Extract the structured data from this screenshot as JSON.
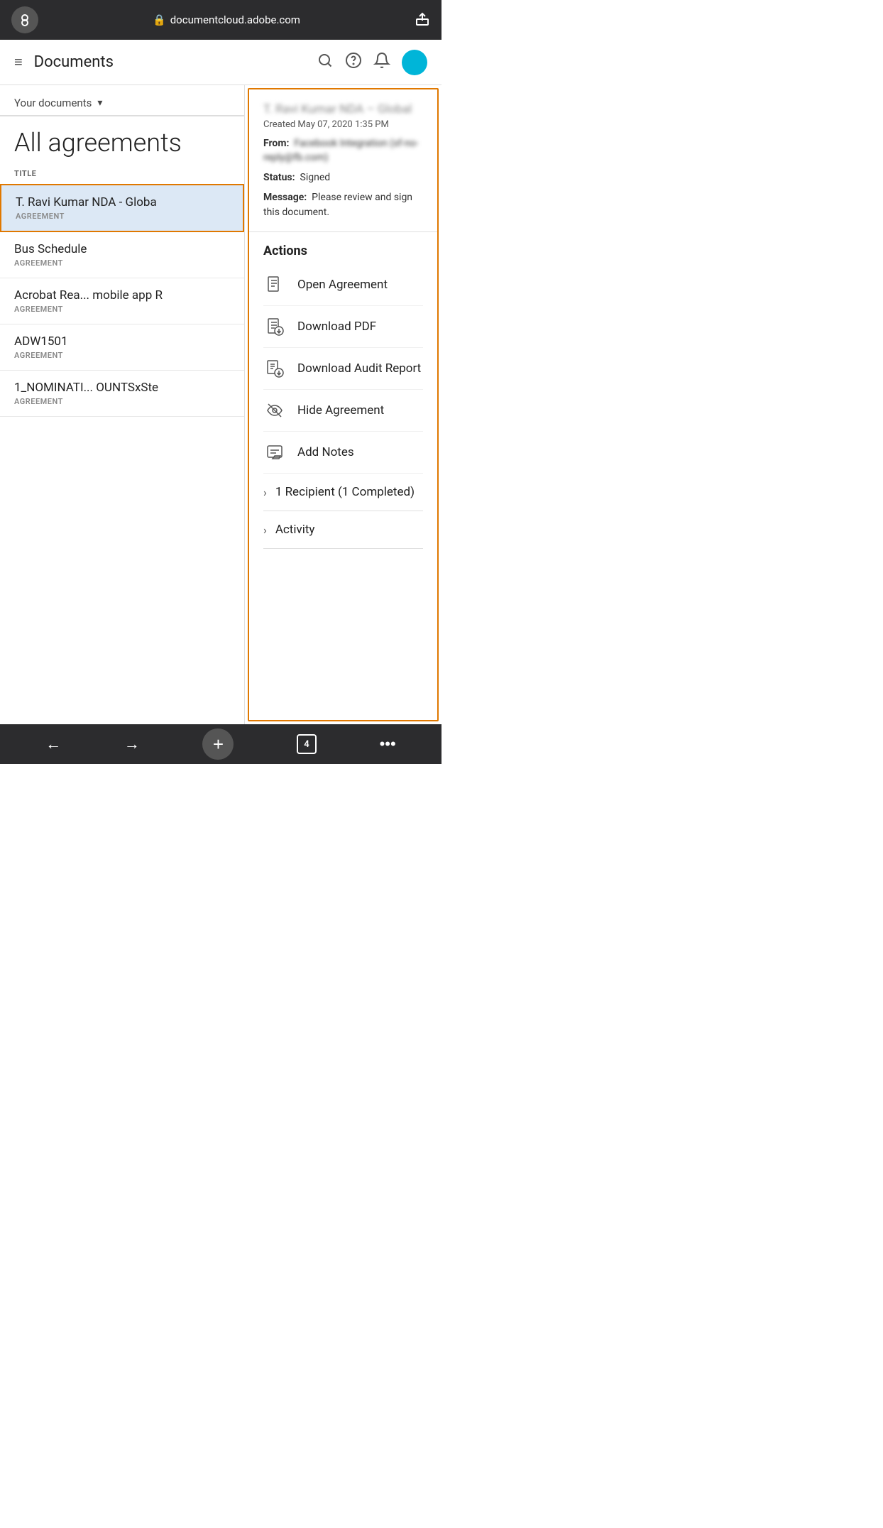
{
  "browser": {
    "url": "documentcloud.adobe.com",
    "icon": "👁",
    "share_icon": "⬆"
  },
  "header": {
    "title": "Documents",
    "hamburger": "≡"
  },
  "filter": {
    "label": "Your documents",
    "chevron": "▾"
  },
  "list": {
    "all_agreements": "All agreements",
    "col_header": "TITLE",
    "items": [
      {
        "name": "T. Ravi Kumar NDA - Globa",
        "type": "AGREEMENT",
        "selected": true
      },
      {
        "name": "Bus Schedule",
        "type": "AGREEMENT",
        "selected": false
      },
      {
        "name": "Acrobat Rea... mobile app R",
        "type": "AGREEMENT",
        "selected": false
      },
      {
        "name": "ADW1501",
        "type": "AGREEMENT",
        "selected": false
      },
      {
        "name": "1_NOMINATI... OUNTSxSte",
        "type": "AGREEMENT",
        "selected": false
      }
    ]
  },
  "detail": {
    "title": "T. Ravi Kumar NDA – Global",
    "created": "Created May 07, 2020 1:35 PM",
    "from_label": "From:",
    "from_value": "Facebook Integration (sf-no-reply@fb.com)",
    "status_label": "Status:",
    "status_value": "Signed",
    "message_label": "Message:",
    "message_value": "Please review and sign this document.",
    "actions_title": "Actions",
    "actions": [
      {
        "id": "open",
        "label": "Open Agreement",
        "icon": "document"
      },
      {
        "id": "download-pdf",
        "label": "Download PDF",
        "icon": "download-pdf"
      },
      {
        "id": "download-audit",
        "label": "Download Audit Report",
        "icon": "download-audit"
      },
      {
        "id": "hide",
        "label": "Hide Agreement",
        "icon": "hide"
      },
      {
        "id": "notes",
        "label": "Add Notes",
        "icon": "notes"
      }
    ],
    "expandable": [
      {
        "id": "recipients",
        "label": "1 Recipient (1 Completed)"
      },
      {
        "id": "activity",
        "label": "Activity"
      }
    ]
  },
  "bottom_bar": {
    "back": "←",
    "forward": "→",
    "add": "+",
    "tabs": "4",
    "more": "•••"
  }
}
